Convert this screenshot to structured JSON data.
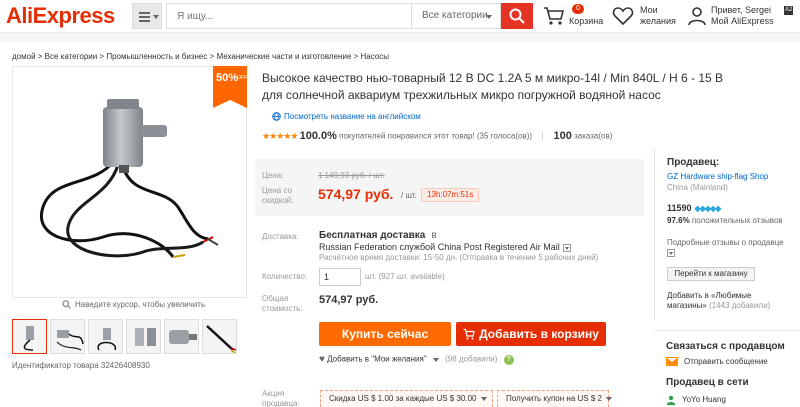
{
  "header": {
    "logo": "AliExpress",
    "search_placeholder": "Я ищу...",
    "search_category": "Все категории",
    "cart_count": "0",
    "cart_label": "Корзина",
    "wishlist_label_1": "Мои",
    "wishlist_label_2": "желания",
    "user_greeting": "Привет, Sergei",
    "user_badge": "A2",
    "user_account": "Мой AliExpress"
  },
  "breadcrumb": "домой > Все категории > Промышленность и бизнес > Механические части и изготовление > Насосы",
  "gallery": {
    "sale_percent": "50%",
    "sale_off": "OFF",
    "zoom_hint": "Наведите курсор, чтобы увеличить",
    "product_id": "Идентификатор товара 32426408930"
  },
  "product": {
    "title": "Высокое качество нью-товарный 12 В DC 1.2A 5 м микро-14l / Min 840L / H 6 - 15 В для солнечной аквариум трехжильных микро погружной водяной насос",
    "translate_link": "Посмотреть название на английском",
    "rating_percent": "100.0%",
    "rating_text": "покупателей понравился этот товар! (35 голоса(ов))",
    "orders_count": "100",
    "orders_label": "заказа(ов)"
  },
  "price": {
    "label": "Цена:",
    "old": "1 149,93 руб. / шт.",
    "sale_label": "Цена со скидкой:",
    "new": "574,97 руб.",
    "per_unit": "/ шт.",
    "timer": "13h:07m:51s"
  },
  "shipping": {
    "label": "Доставка:",
    "title": "Бесплатная доставка",
    "to_word": "в",
    "line": "Russian Federation службой China Post Registered Air Mail",
    "time": "Расчётное время доставки: 15-50 дн. (Отправка в течение 5 рабочих дней)"
  },
  "quantity": {
    "label": "Количество:",
    "value": "1",
    "note": "шт. (927 шт. available)"
  },
  "total": {
    "label": "Общая стоимость:",
    "value": "574,97 руб."
  },
  "actions": {
    "buy": "Купить сейчас",
    "add_to_cart": "Добавить в корзину",
    "wishlist": "Добавить в \"Мои желания\"",
    "wishlist_count": "(98 добавили)"
  },
  "promo": {
    "label": "Акция продавца:",
    "coupon1": "Скидка US $ 1.00 за каждые US $ 30.00",
    "coupon2": "Получить купон на US $ 2"
  },
  "seller": {
    "title": "Продавец:",
    "store": "GZ Hardware ship-flag Shop",
    "country": "China (Mainland)",
    "score": "11590",
    "feedback_percent": "97.6%",
    "feedback_text": "положительных отзывов",
    "similar_text": "Подробные отзывы о продавце",
    "store_button": "Перейти к магазину",
    "favorites_text": "Добавить в «Любимые магазины»",
    "favorites_count": "(1443 добавили)",
    "contact_title": "Связаться с продавцом",
    "contact_msg": "Отправить сообщение",
    "online_title": "Продавец в сети",
    "online_user": "YoYo Huang"
  },
  "colors": {
    "brand": "#e62e04",
    "buy_button": "#ff6a00",
    "price": "#e62e04",
    "link": "#0066cc"
  }
}
